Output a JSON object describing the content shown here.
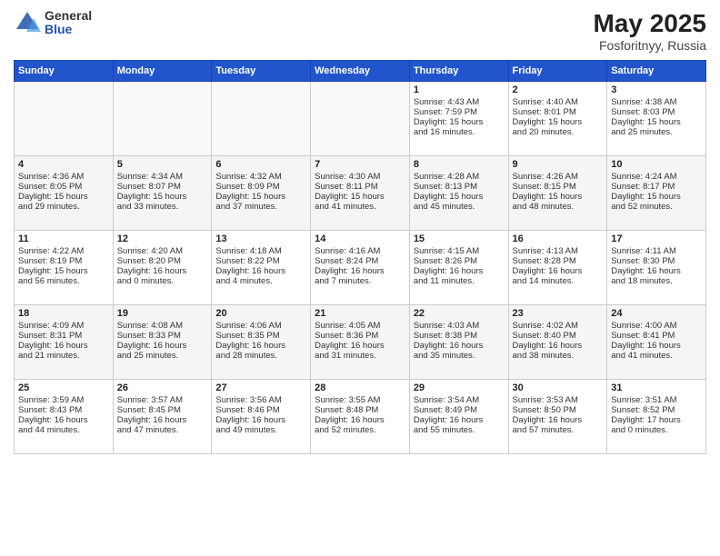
{
  "logo": {
    "general": "General",
    "blue": "Blue"
  },
  "title": "May 2025",
  "subtitle": "Fosforitnyy, Russia",
  "days_header": [
    "Sunday",
    "Monday",
    "Tuesday",
    "Wednesday",
    "Thursday",
    "Friday",
    "Saturday"
  ],
  "rows": [
    [
      {
        "num": "",
        "lines": []
      },
      {
        "num": "",
        "lines": []
      },
      {
        "num": "",
        "lines": []
      },
      {
        "num": "",
        "lines": []
      },
      {
        "num": "1",
        "lines": [
          "Sunrise: 4:43 AM",
          "Sunset: 7:59 PM",
          "Daylight: 15 hours",
          "and 16 minutes."
        ]
      },
      {
        "num": "2",
        "lines": [
          "Sunrise: 4:40 AM",
          "Sunset: 8:01 PM",
          "Daylight: 15 hours",
          "and 20 minutes."
        ]
      },
      {
        "num": "3",
        "lines": [
          "Sunrise: 4:38 AM",
          "Sunset: 8:03 PM",
          "Daylight: 15 hours",
          "and 25 minutes."
        ]
      }
    ],
    [
      {
        "num": "4",
        "lines": [
          "Sunrise: 4:36 AM",
          "Sunset: 8:05 PM",
          "Daylight: 15 hours",
          "and 29 minutes."
        ]
      },
      {
        "num": "5",
        "lines": [
          "Sunrise: 4:34 AM",
          "Sunset: 8:07 PM",
          "Daylight: 15 hours",
          "and 33 minutes."
        ]
      },
      {
        "num": "6",
        "lines": [
          "Sunrise: 4:32 AM",
          "Sunset: 8:09 PM",
          "Daylight: 15 hours",
          "and 37 minutes."
        ]
      },
      {
        "num": "7",
        "lines": [
          "Sunrise: 4:30 AM",
          "Sunset: 8:11 PM",
          "Daylight: 15 hours",
          "and 41 minutes."
        ]
      },
      {
        "num": "8",
        "lines": [
          "Sunrise: 4:28 AM",
          "Sunset: 8:13 PM",
          "Daylight: 15 hours",
          "and 45 minutes."
        ]
      },
      {
        "num": "9",
        "lines": [
          "Sunrise: 4:26 AM",
          "Sunset: 8:15 PM",
          "Daylight: 15 hours",
          "and 48 minutes."
        ]
      },
      {
        "num": "10",
        "lines": [
          "Sunrise: 4:24 AM",
          "Sunset: 8:17 PM",
          "Daylight: 15 hours",
          "and 52 minutes."
        ]
      }
    ],
    [
      {
        "num": "11",
        "lines": [
          "Sunrise: 4:22 AM",
          "Sunset: 8:19 PM",
          "Daylight: 15 hours",
          "and 56 minutes."
        ]
      },
      {
        "num": "12",
        "lines": [
          "Sunrise: 4:20 AM",
          "Sunset: 8:20 PM",
          "Daylight: 16 hours",
          "and 0 minutes."
        ]
      },
      {
        "num": "13",
        "lines": [
          "Sunrise: 4:18 AM",
          "Sunset: 8:22 PM",
          "Daylight: 16 hours",
          "and 4 minutes."
        ]
      },
      {
        "num": "14",
        "lines": [
          "Sunrise: 4:16 AM",
          "Sunset: 8:24 PM",
          "Daylight: 16 hours",
          "and 7 minutes."
        ]
      },
      {
        "num": "15",
        "lines": [
          "Sunrise: 4:15 AM",
          "Sunset: 8:26 PM",
          "Daylight: 16 hours",
          "and 11 minutes."
        ]
      },
      {
        "num": "16",
        "lines": [
          "Sunrise: 4:13 AM",
          "Sunset: 8:28 PM",
          "Daylight: 16 hours",
          "and 14 minutes."
        ]
      },
      {
        "num": "17",
        "lines": [
          "Sunrise: 4:11 AM",
          "Sunset: 8:30 PM",
          "Daylight: 16 hours",
          "and 18 minutes."
        ]
      }
    ],
    [
      {
        "num": "18",
        "lines": [
          "Sunrise: 4:09 AM",
          "Sunset: 8:31 PM",
          "Daylight: 16 hours",
          "and 21 minutes."
        ]
      },
      {
        "num": "19",
        "lines": [
          "Sunrise: 4:08 AM",
          "Sunset: 8:33 PM",
          "Daylight: 16 hours",
          "and 25 minutes."
        ]
      },
      {
        "num": "20",
        "lines": [
          "Sunrise: 4:06 AM",
          "Sunset: 8:35 PM",
          "Daylight: 16 hours",
          "and 28 minutes."
        ]
      },
      {
        "num": "21",
        "lines": [
          "Sunrise: 4:05 AM",
          "Sunset: 8:36 PM",
          "Daylight: 16 hours",
          "and 31 minutes."
        ]
      },
      {
        "num": "22",
        "lines": [
          "Sunrise: 4:03 AM",
          "Sunset: 8:38 PM",
          "Daylight: 16 hours",
          "and 35 minutes."
        ]
      },
      {
        "num": "23",
        "lines": [
          "Sunrise: 4:02 AM",
          "Sunset: 8:40 PM",
          "Daylight: 16 hours",
          "and 38 minutes."
        ]
      },
      {
        "num": "24",
        "lines": [
          "Sunrise: 4:00 AM",
          "Sunset: 8:41 PM",
          "Daylight: 16 hours",
          "and 41 minutes."
        ]
      }
    ],
    [
      {
        "num": "25",
        "lines": [
          "Sunrise: 3:59 AM",
          "Sunset: 8:43 PM",
          "Daylight: 16 hours",
          "and 44 minutes."
        ]
      },
      {
        "num": "26",
        "lines": [
          "Sunrise: 3:57 AM",
          "Sunset: 8:45 PM",
          "Daylight: 16 hours",
          "and 47 minutes."
        ]
      },
      {
        "num": "27",
        "lines": [
          "Sunrise: 3:56 AM",
          "Sunset: 8:46 PM",
          "Daylight: 16 hours",
          "and 49 minutes."
        ]
      },
      {
        "num": "28",
        "lines": [
          "Sunrise: 3:55 AM",
          "Sunset: 8:48 PM",
          "Daylight: 16 hours",
          "and 52 minutes."
        ]
      },
      {
        "num": "29",
        "lines": [
          "Sunrise: 3:54 AM",
          "Sunset: 8:49 PM",
          "Daylight: 16 hours",
          "and 55 minutes."
        ]
      },
      {
        "num": "30",
        "lines": [
          "Sunrise: 3:53 AM",
          "Sunset: 8:50 PM",
          "Daylight: 16 hours",
          "and 57 minutes."
        ]
      },
      {
        "num": "31",
        "lines": [
          "Sunrise: 3:51 AM",
          "Sunset: 8:52 PM",
          "Daylight: 17 hours",
          "and 0 minutes."
        ]
      }
    ]
  ]
}
